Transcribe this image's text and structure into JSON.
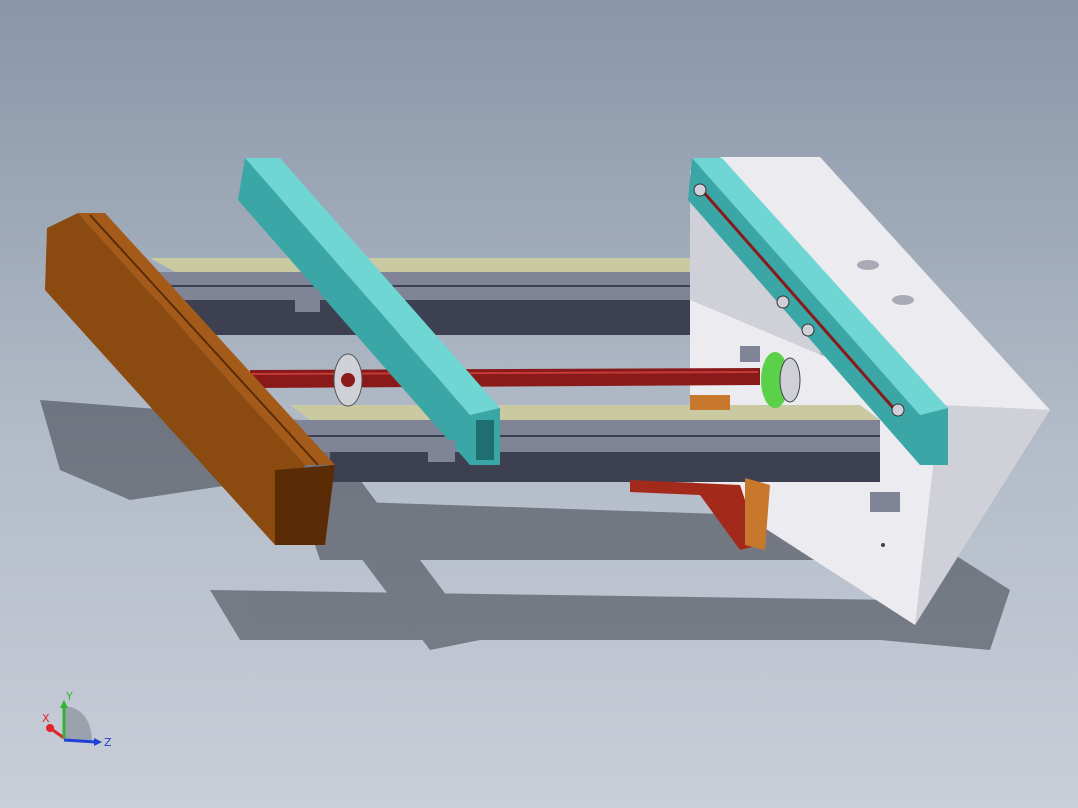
{
  "viewport": {
    "background": {
      "top": "#8996a8",
      "mid": "#b3bcc8",
      "bottom": "#c9ced8"
    }
  },
  "colors": {
    "wood_front": "#8a4a10",
    "wood_top": "#a45b1a",
    "wood_end": "#5a2c06",
    "teal_top": "#6fd6d4",
    "teal_side": "#3aa6a6",
    "teal_dark": "#1f6f70",
    "rail_light": "#c9c9a2",
    "rail_mid": "#7f8596",
    "rail_dark": "#3c4050",
    "rod_red": "#8a1a1a",
    "rod_highlight": "#c33a3a",
    "plate_front": "#ececf0",
    "plate_side": "#d0d0d8",
    "plate_dark": "#a9aab5",
    "pulley_green": "#5bd04a",
    "motor_red": "#a32a1a",
    "bracket_orange": "#c8782c",
    "shadow": "#3a3e47"
  },
  "triad": {
    "x_label": "X",
    "y_label": "Y",
    "z_label": "Z",
    "x_color": "#e0242a",
    "y_color": "#2fb62f",
    "z_color": "#1f3fd8"
  }
}
